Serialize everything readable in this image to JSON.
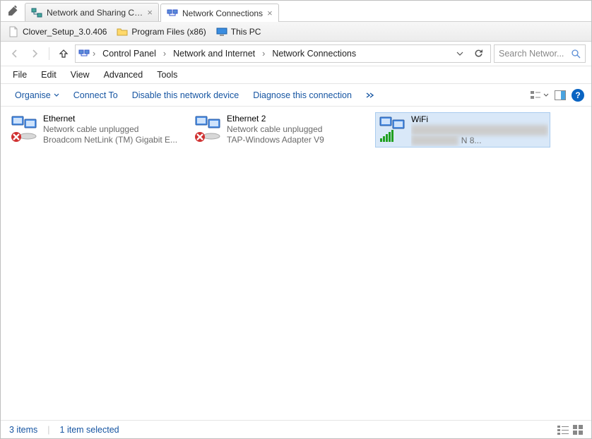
{
  "window": {
    "tabs": [
      {
        "title": "Network and Sharing Cent",
        "active": false
      },
      {
        "title": "Network Connections",
        "active": true
      }
    ]
  },
  "bookmarks": [
    {
      "label": "Clover_Setup_3.0.406",
      "kind": "file"
    },
    {
      "label": "Program Files (x86)",
      "kind": "folder"
    },
    {
      "label": "This PC",
      "kind": "pc"
    }
  ],
  "breadcrumb": {
    "segments": [
      "Control Panel",
      "Network and Internet",
      "Network Connections"
    ]
  },
  "search": {
    "placeholder": "Search Networ..."
  },
  "menubar": [
    "File",
    "Edit",
    "View",
    "Advanced",
    "Tools"
  ],
  "toolbar": {
    "organise": "Organise",
    "connect_to": "Connect To",
    "disable": "Disable this network device",
    "diagnose": "Diagnose this connection"
  },
  "connections": [
    {
      "name": "Ethernet",
      "status": "Network cable unplugged",
      "device": "Broadcom NetLink (TM) Gigabit E...",
      "kind": "wired-unplugged",
      "selected": false
    },
    {
      "name": "Ethernet 2",
      "status": "Network cable unplugged",
      "device": "TAP-Windows Adapter V9",
      "kind": "wired-unplugged",
      "selected": false
    },
    {
      "name": "WiFi",
      "status": "",
      "device": "N 8...",
      "kind": "wifi",
      "selected": true
    }
  ],
  "statusbar": {
    "count": "3 items",
    "selection": "1 item selected"
  }
}
